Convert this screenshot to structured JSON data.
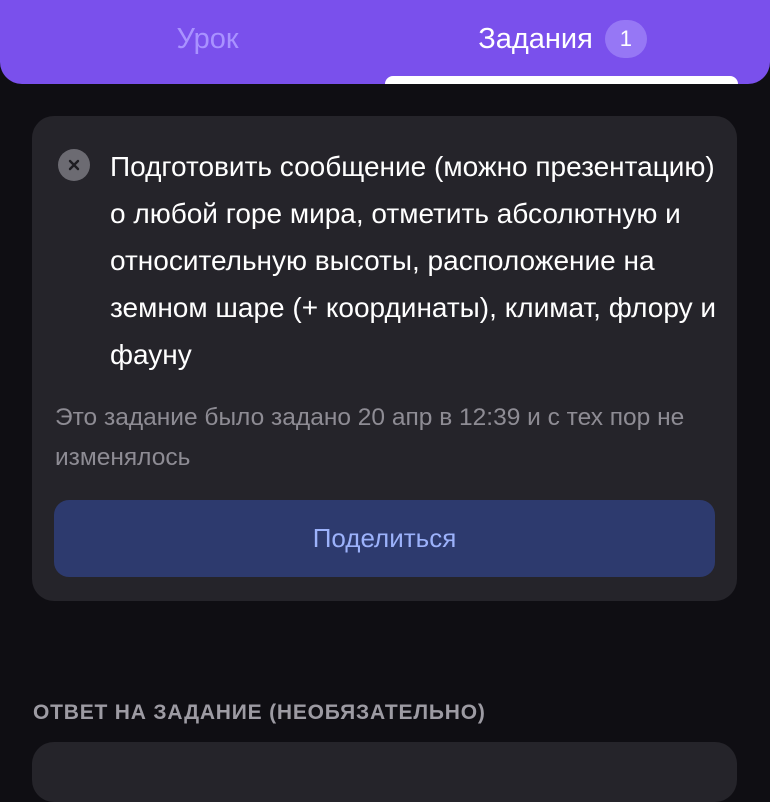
{
  "tabs": {
    "lesson": {
      "label": "Урок"
    },
    "tasks": {
      "label": "Задания",
      "badge": "1"
    }
  },
  "task": {
    "status_icon": "close-icon",
    "text": "Подготовить сообщение (можно презентацию) о любой горе мира, отметить абсолютную и относительную высоты, расположение на земном шаре (+ координаты), климат, флору и фауну",
    "meta": "Это задание было задано 20 апр в 12:39 и с тех пор не изменялось",
    "share_label": "Поделиться"
  },
  "answer": {
    "heading": "ОТВЕТ НА ЗАДАНИЕ (НЕОБЯЗАТЕЛЬНО)"
  },
  "colors": {
    "background": "#0f0e13",
    "header": "#7a50ec",
    "card": "#25242a",
    "share_button": "#2d3a6e",
    "share_text": "#9cb2fb",
    "inactive_tab": "#a992ff"
  }
}
